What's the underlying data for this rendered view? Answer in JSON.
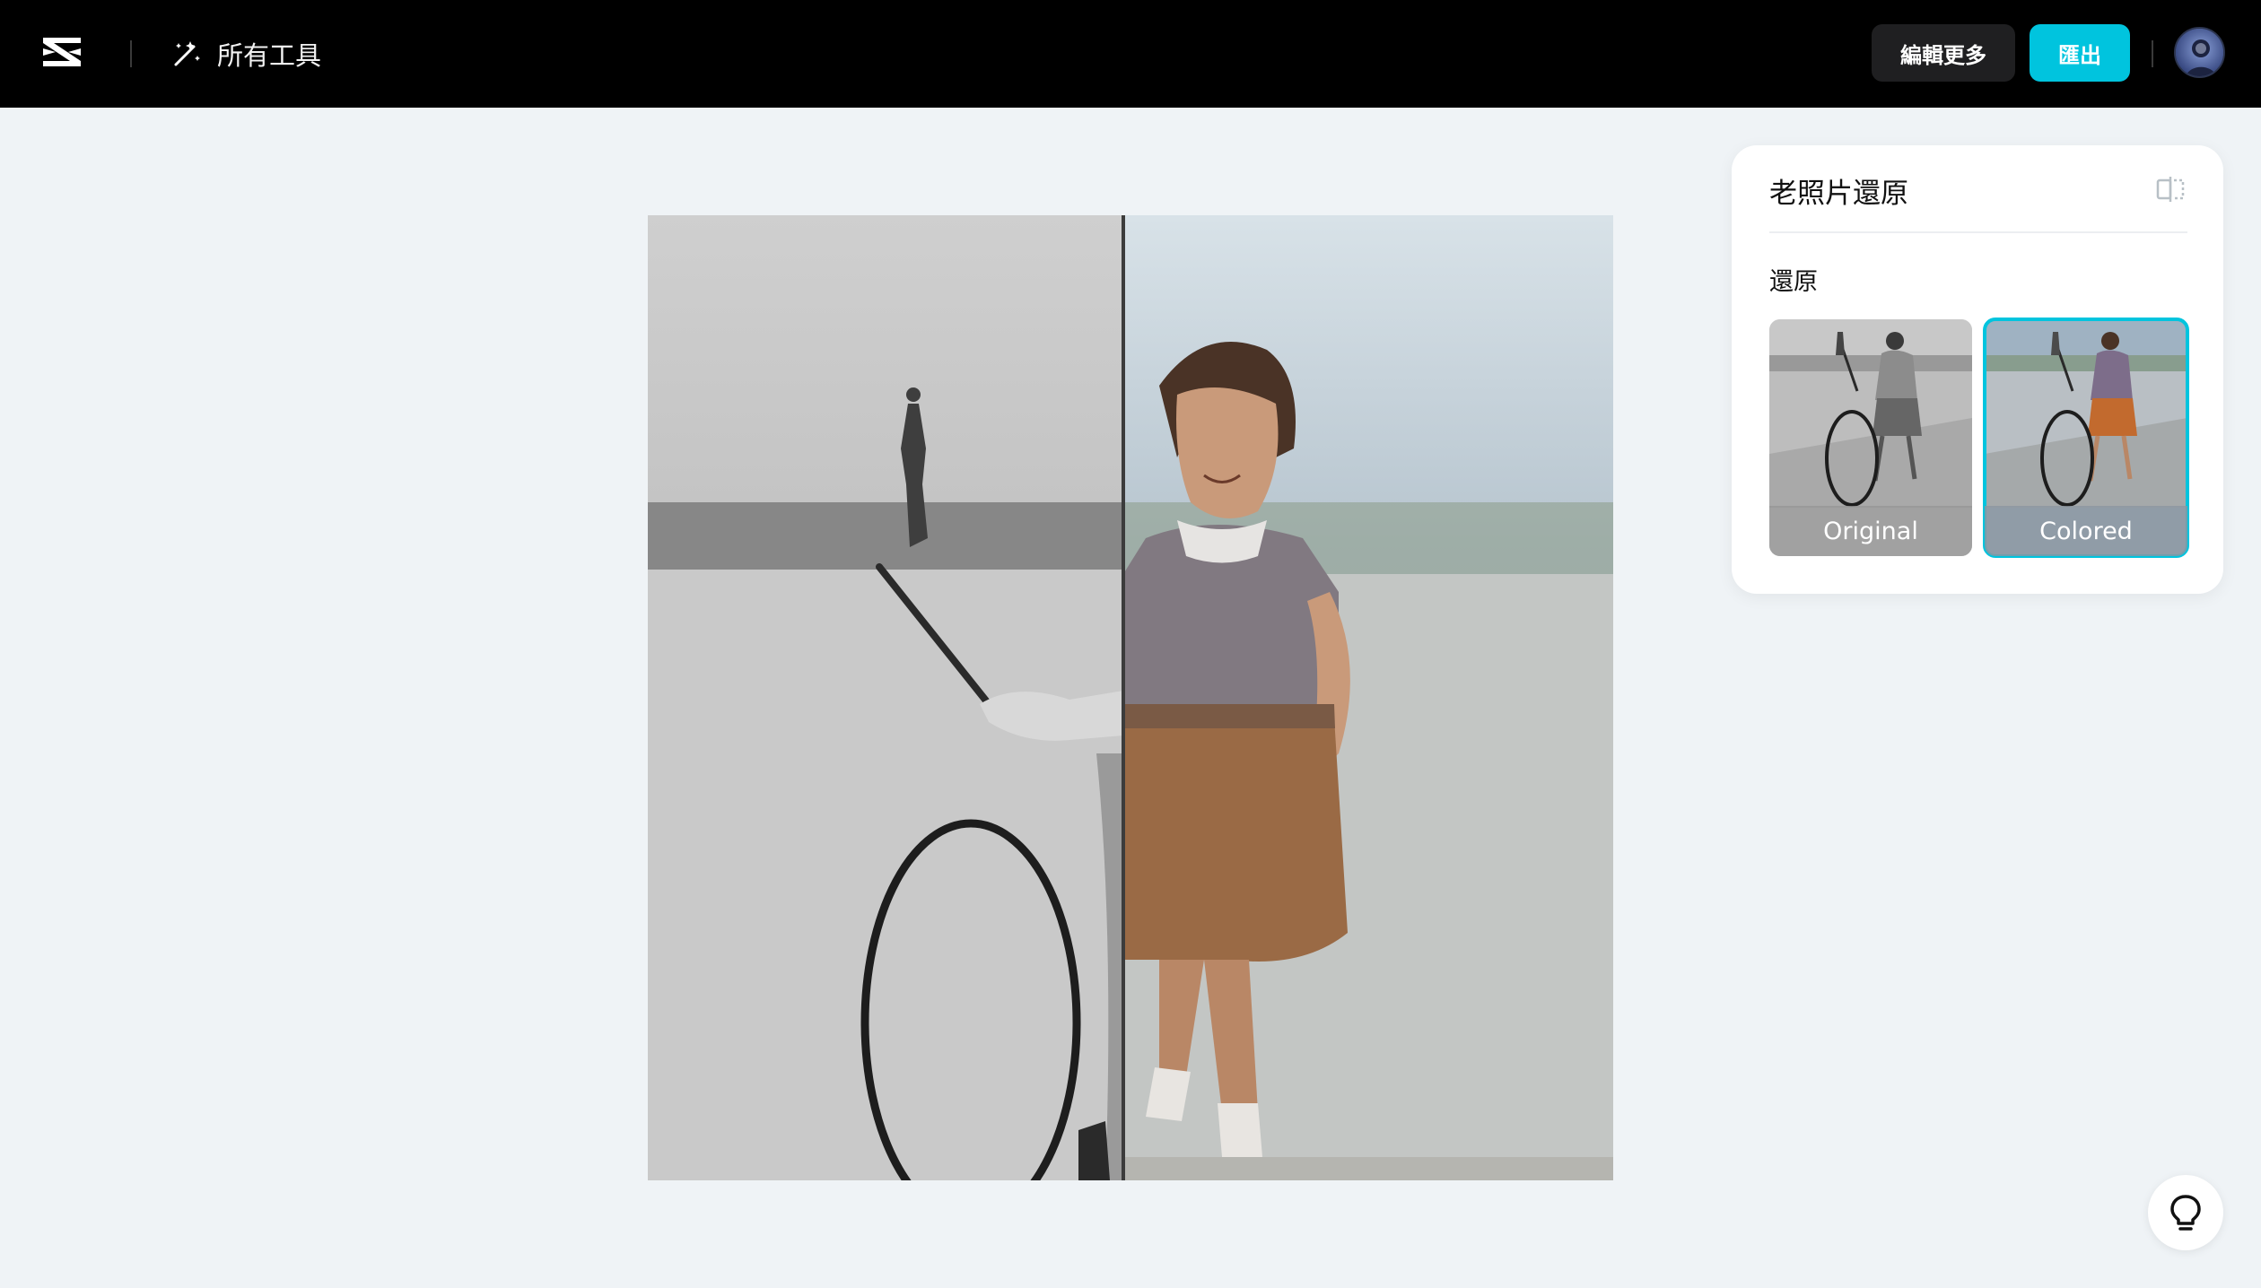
{
  "header": {
    "logo_icon": "capcut-logo-icon",
    "tools_icon": "magic-wand-icon",
    "tools_label": "所有工具",
    "edit_more_label": "編輯更多",
    "export_label": "匯出",
    "avatar_icon": "user-avatar"
  },
  "canvas": {
    "left_state": "Original",
    "right_state": "Colored"
  },
  "panel": {
    "title": "老照片還原",
    "compare_icon": "compare-split-icon",
    "section_label": "還原",
    "options": [
      {
        "label": "Original",
        "selected": false
      },
      {
        "label": "Colored",
        "selected": true
      }
    ],
    "accent_color": "#00c4de"
  },
  "help": {
    "icon": "lightbulb-icon"
  }
}
